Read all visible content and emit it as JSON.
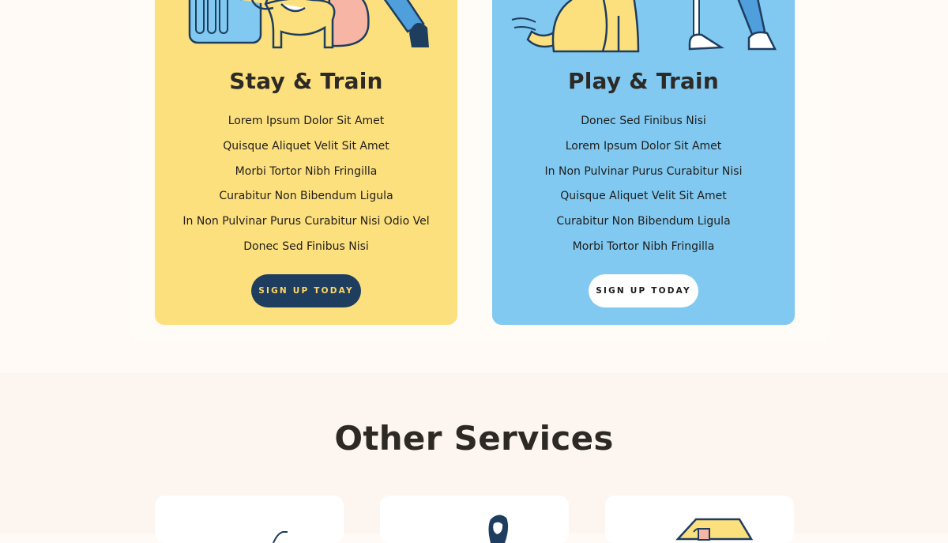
{
  "pricing": {
    "cards": [
      {
        "title": "Stay & Train",
        "features": [
          "Lorem Ipsum Dolor Sit Amet",
          "Quisque Aliquet Velit Sit Amet",
          "Morbi Tortor Nibh Fringilla",
          "Curabitur Non Bibendum Ligula",
          "In Non Pulvinar Purus Curabitur Nisi Odio Vel",
          "Donec Sed Finibus Nisi"
        ],
        "cta_label": "SIGN UP TODAY",
        "background": "#fde07e",
        "cta_background": "#1f3d5e",
        "cta_text_color": "#ffd864",
        "illustration": "dog-in-crate-illustration"
      },
      {
        "title": "Play & Train",
        "features": [
          "Donec Sed Finibus Nisi",
          "Lorem Ipsum Dolor Sit Amet",
          "In Non Pulvinar Purus Curabitur Nisi",
          "Quisque Aliquet Velit Sit Amet",
          "Curabitur Non Bibendum Ligula",
          "Morbi Tortor Nibh Fringilla"
        ],
        "cta_label": "SIGN UP TODAY",
        "background": "#81c9f1",
        "cta_background": "#ffffff",
        "cta_text_color": "#1a1a1a",
        "illustration": "sitting-dog-with-owner-illustration"
      }
    ]
  },
  "services": {
    "heading": "Other Services",
    "cards": [
      {
        "illustration": "service-illustration-1"
      },
      {
        "illustration": "groomer-person-illustration"
      },
      {
        "illustration": "dog-house-illustration"
      }
    ]
  },
  "colors": {
    "page_background": "#fffaf5",
    "services_background": "#fdf5ef",
    "heading_text": "#2d2a26",
    "navy": "#1f3d5e"
  }
}
